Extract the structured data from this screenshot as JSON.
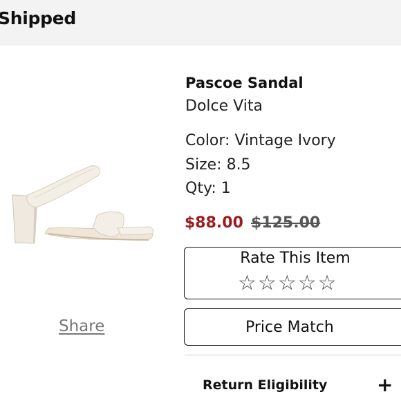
{
  "header": {
    "title": "Shipped"
  },
  "product": {
    "image_alt": "sandal-image",
    "name": "Pascoe Sandal",
    "brand": "Dolce Vita",
    "color": "Color: Vintage Ivory",
    "size": "Size: 8.5",
    "qty": "Qty: 1",
    "sale_price": "$88.00",
    "original_price": "$125.00"
  },
  "share_label": "Share",
  "rating": {
    "title": "Rate This Item",
    "stars": [
      "☆",
      "☆",
      "☆",
      "☆",
      "☆"
    ],
    "current": 0,
    "max": 5
  },
  "price_match_label": "Price Match",
  "return_eligibility": {
    "label": "Return Eligibility",
    "icon": "+"
  },
  "colors": {
    "sale": "#9b1c1c",
    "header_bg": "#f3f3f3"
  }
}
